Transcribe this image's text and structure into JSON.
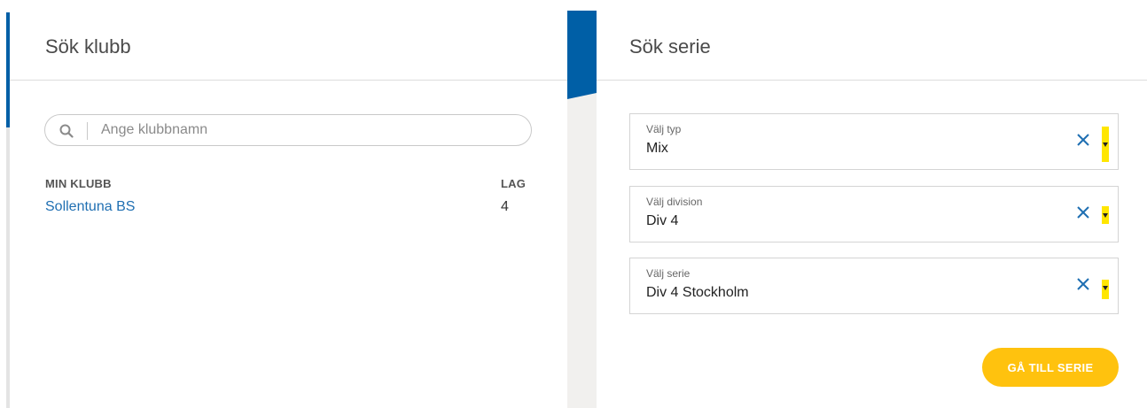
{
  "club_search": {
    "title": "Sök klubb",
    "search_placeholder": "Ange klubbnamn",
    "search_value": "",
    "column_club": "MIN KLUBB",
    "column_teams": "LAG",
    "clubs": [
      {
        "name": "Sollentuna BS",
        "teams": "4"
      }
    ]
  },
  "series_search": {
    "title": "Sök serie",
    "selects": [
      {
        "label": "Välj typ",
        "value": "Mix"
      },
      {
        "label": "Välj division",
        "value": "Div 4"
      },
      {
        "label": "Välj serie",
        "value": "Div 4 Stockholm"
      }
    ],
    "goto_label": "GÅ TILL SERIE"
  },
  "icons": {
    "search": "search-icon",
    "clear": "close-icon",
    "dropdown": "caret-down-icon"
  },
  "colors": {
    "accent_blue": "#005fa6",
    "link_blue": "#1f6fb2",
    "button_yellow": "#ffc20e",
    "highlight_yellow": "#ffe600",
    "gutter_gray": "#f1f0ee"
  }
}
